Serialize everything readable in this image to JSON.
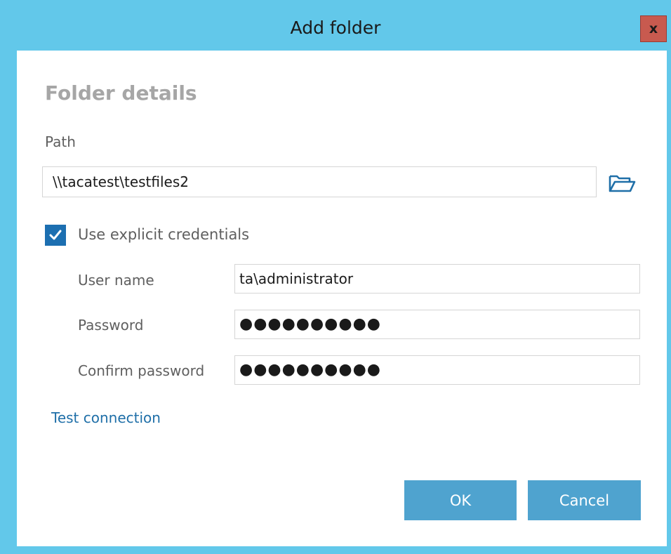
{
  "window": {
    "title": "Add folder",
    "close_label": "x"
  },
  "form": {
    "section_title": "Folder details",
    "path_label": "Path",
    "path_value": "\\\\tacatest\\testfiles2",
    "browse_icon": "folder-open-icon",
    "credentials_checkbox": {
      "label": "Use explicit credentials",
      "checked": true
    },
    "user_name_label": "User name",
    "user_name_value": "ta\\administrator",
    "password_label": "Password",
    "password_value": "●●●●●●●●●●",
    "confirm_password_label": "Confirm password",
    "confirm_password_value": "●●●●●●●●●●",
    "test_connection_label": "Test connection"
  },
  "buttons": {
    "ok_label": "OK",
    "cancel_label": "Cancel"
  },
  "colors": {
    "title_bar": "#62c8ea",
    "close_button": "#c85a4f",
    "primary_button": "#4fa3cf",
    "checkbox": "#1c6fb1",
    "link": "#1f6fa8"
  }
}
